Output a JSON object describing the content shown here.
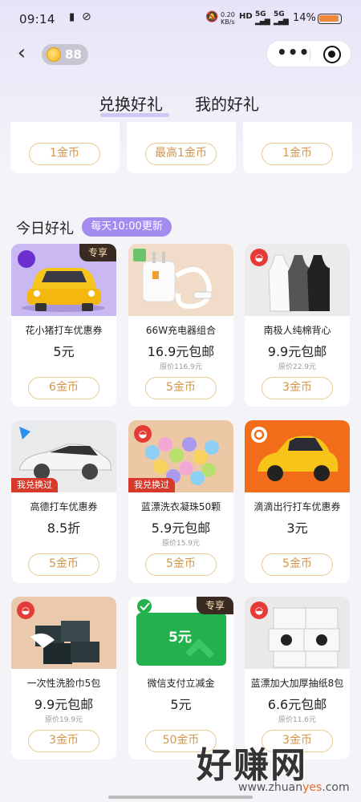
{
  "status_bar": {
    "time": "09:14",
    "net_speed": "0.20 KB/s",
    "network": "5G",
    "battery_pct": "14%"
  },
  "header": {
    "back_icon": "‹",
    "coin_count": "88",
    "more_icon": "•••"
  },
  "tabs": [
    {
      "label": "兑换好礼",
      "active": true
    },
    {
      "label": "我的好礼",
      "active": false
    }
  ],
  "prev_row": [
    {
      "btn": "1金币"
    },
    {
      "btn": "最高1金币"
    },
    {
      "btn": "1金币"
    }
  ],
  "section": {
    "title": "今日好礼",
    "badge": "每天10:00更新"
  },
  "tags": {
    "exclusive": "专享",
    "redeemed": "我兑换过"
  },
  "products": [
    {
      "name": "花小猪打车优惠券",
      "price": "5元",
      "orig": "",
      "btn": "6金币"
    },
    {
      "name": "66W充电器组合",
      "price": "16.9元包邮",
      "orig": "原价116.9元",
      "btn": "5金币"
    },
    {
      "name": "南极人纯棉背心",
      "price": "9.9元包邮",
      "orig": "原价22.9元",
      "btn": "3金币"
    },
    {
      "name": "高德打车优惠券",
      "price": "8.5折",
      "orig": "",
      "btn": "5金币"
    },
    {
      "name": "蓝漂洗衣凝珠50颗",
      "price": "5.9元包邮",
      "orig": "原价15.9元",
      "btn": "5金币"
    },
    {
      "name": "滴滴出行打车优惠券",
      "price": "3元",
      "orig": "",
      "btn": "5金币"
    },
    {
      "name": "一次性洗脸巾5包",
      "price": "9.9元包邮",
      "orig": "原价19.9元",
      "btn": "3金币"
    },
    {
      "name": "微信支付立减金",
      "price": "5元",
      "orig": "",
      "btn": "50金币",
      "voucher_value": "5元"
    },
    {
      "name": "蓝漂加大加厚抽纸8包",
      "price": "6.6元包邮",
      "orig": "原价11.6元",
      "btn": "3金币"
    }
  ],
  "watermark": {
    "big": "好赚网",
    "url_a": "www.zhuan",
    "url_b": "yes",
    "url_c": ".com"
  }
}
